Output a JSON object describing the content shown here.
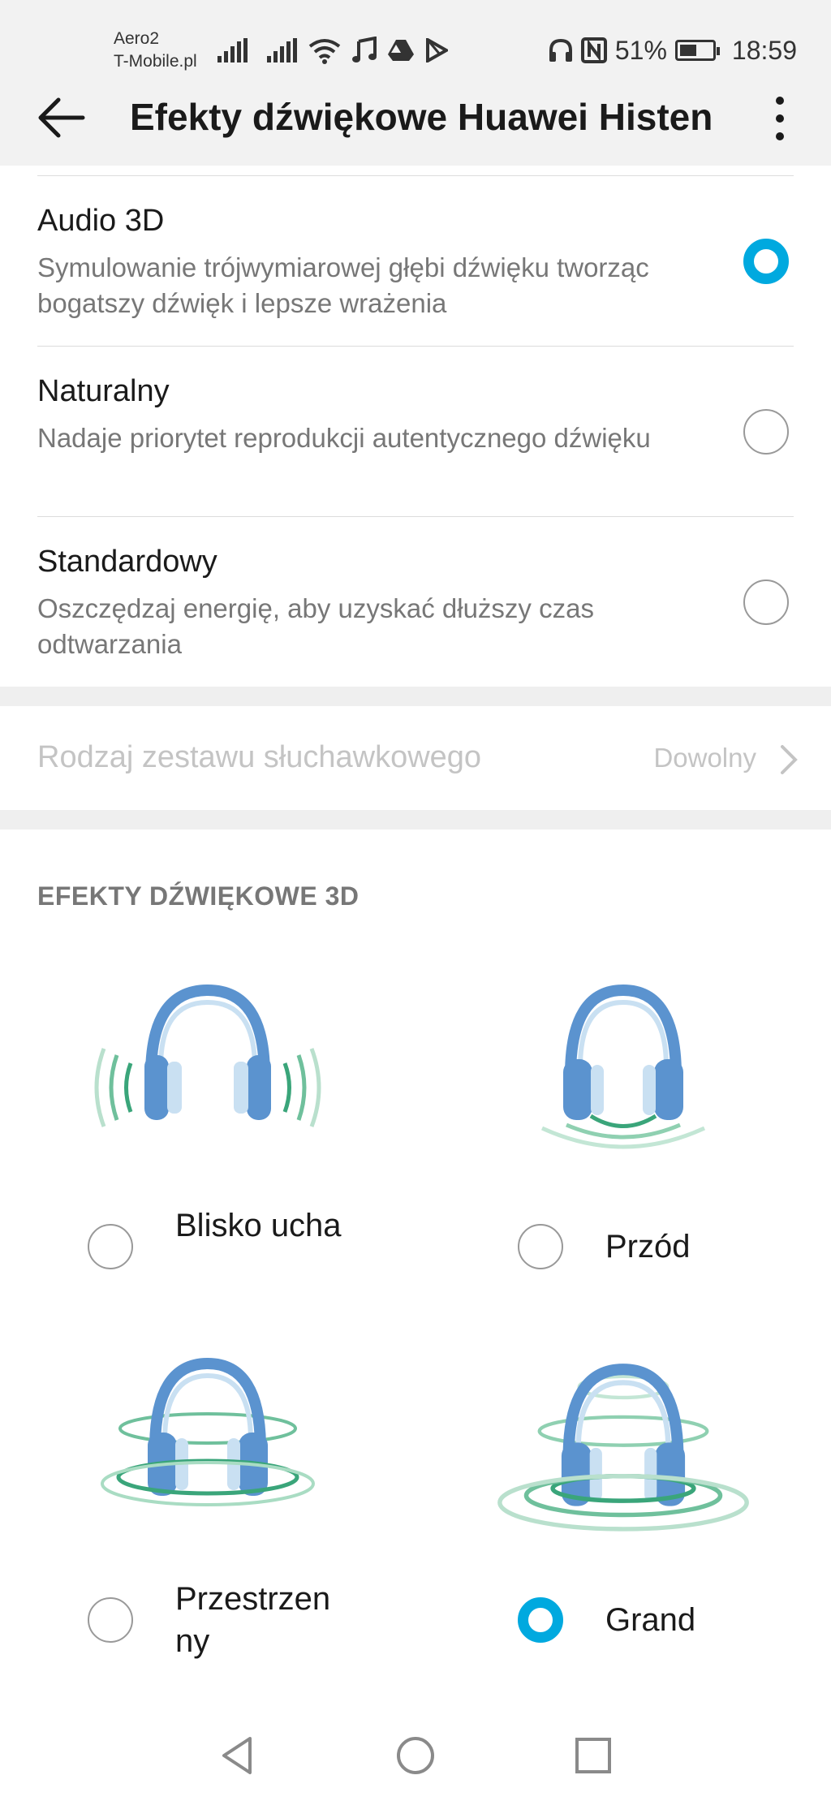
{
  "status_bar": {
    "carrier_line1": "Aero2",
    "carrier_line2": "T-Mobile.pl",
    "battery": "51%",
    "time": "18:59"
  },
  "header": {
    "title": "Efekty dźwiękowe Huawei Histen"
  },
  "modes": [
    {
      "title": "Audio 3D",
      "description": "Symulowanie trójwymiarowej głębi dźwięku tworząc bogatszy dźwięk i lepsze wrażenia",
      "selected": true
    },
    {
      "title": "Naturalny",
      "description": "Nadaje priorytet reprodukcji autentycznego dźwięku",
      "selected": false
    },
    {
      "title": "Standardowy",
      "description": "Oszczędzaj energię, aby uzyskać dłuższy czas odtwarzania",
      "selected": false
    }
  ],
  "headset": {
    "label": "Rodzaj zestawu słuchawkowego",
    "value": "Dowolny"
  },
  "effects_section": {
    "header": "EFEKTY DŹWIĘKOWE 3D",
    "items": [
      {
        "label": "Blisko ucha",
        "selected": false
      },
      {
        "label": "Przód",
        "selected": false
      },
      {
        "label": "Przestrzenny",
        "selected": false
      },
      {
        "label": "Grand",
        "selected": true
      }
    ]
  },
  "colors": {
    "accent": "#00a9df",
    "headphone_blue": "#5b93cf",
    "wave_green": "#3aa57a"
  }
}
